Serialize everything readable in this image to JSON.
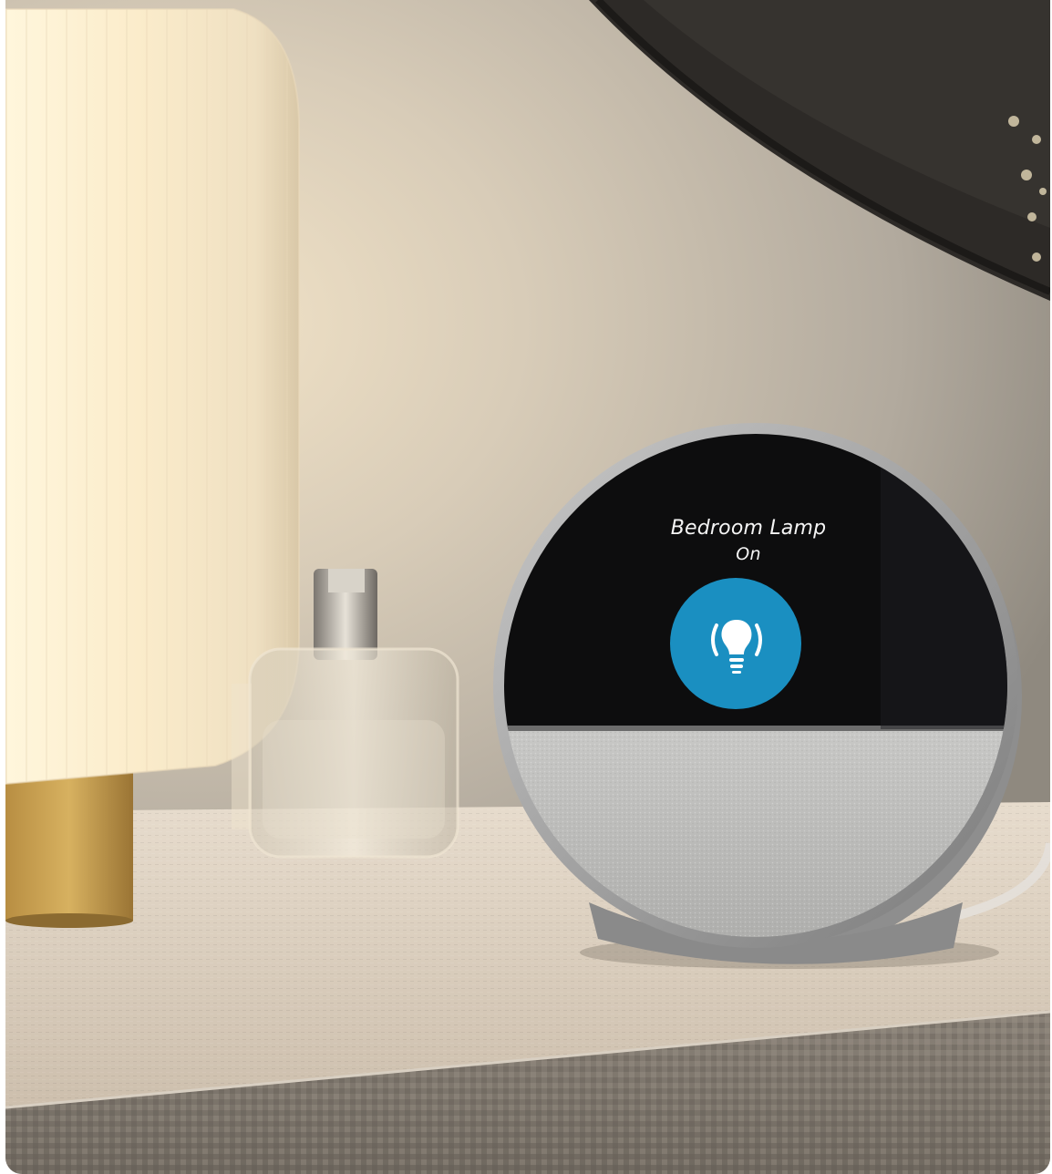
{
  "device_screen": {
    "device_name": "Bedroom Lamp",
    "device_status": "On",
    "icon": "lightbulb-icon",
    "icon_bg_color": "#1a8fc1"
  }
}
